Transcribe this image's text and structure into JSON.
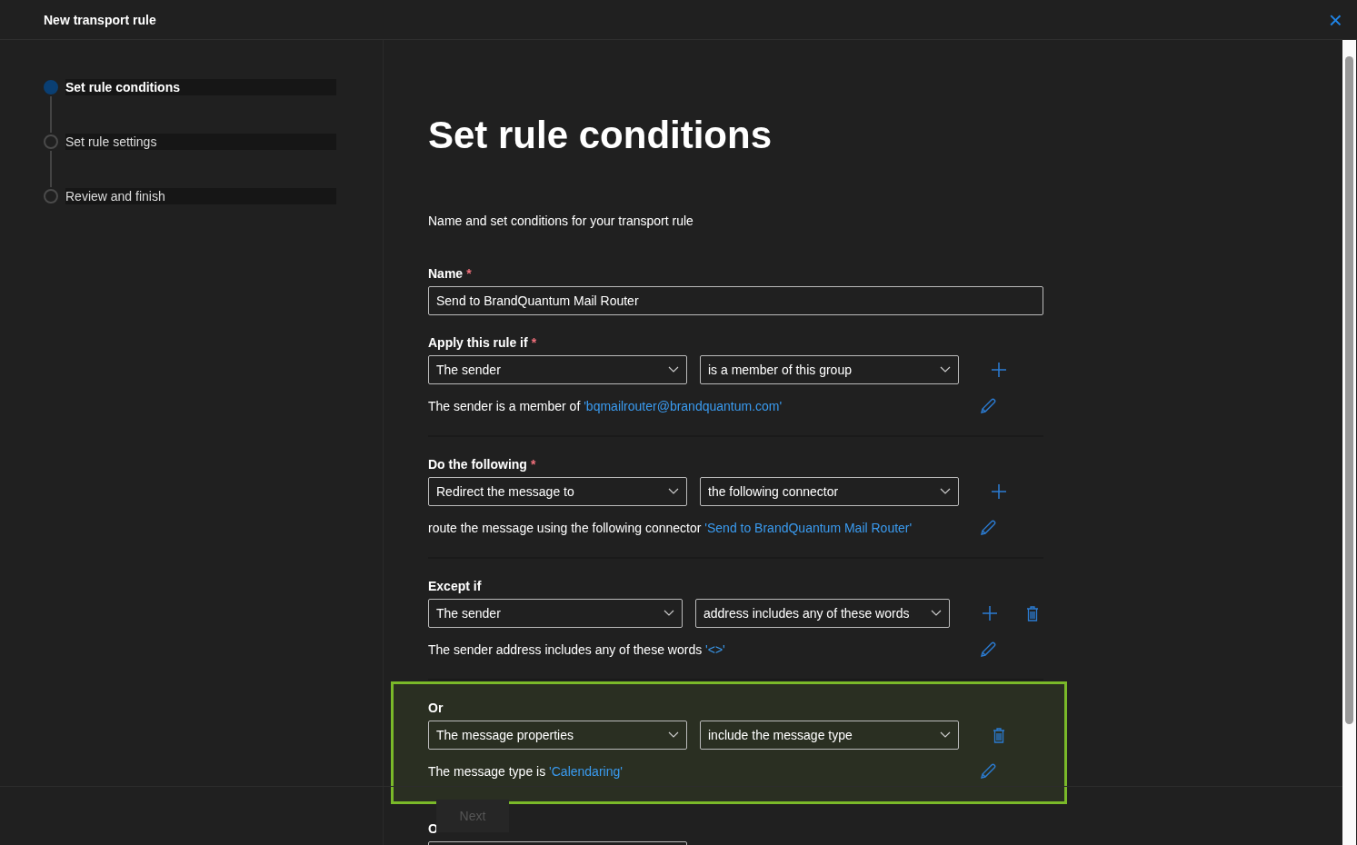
{
  "window": {
    "title": "New transport rule",
    "close": "×"
  },
  "steps": [
    {
      "label": "Set rule conditions",
      "selected": true
    },
    {
      "label": "Set rule settings",
      "selected": false
    },
    {
      "label": "Review and finish",
      "selected": false
    }
  ],
  "required_symbol": "*",
  "page_title": "Set rule conditions",
  "description": "Name and set conditions for your transport rule",
  "name_field": {
    "label": "Name",
    "required": true,
    "value": "Send to BrandQuantum Mail Router"
  },
  "sections": [
    {
      "title": "Apply this rule if",
      "required": true,
      "subject": "The sender",
      "condition": "is a member of this group",
      "summary": "The sender is a member of ",
      "value": "'bqmailrouter@brandquantum.com'",
      "can_add": true
    },
    {
      "title": "Do the following",
      "required": true,
      "subject": "Redirect the message to",
      "condition": "the following connector",
      "summary": "route the message using the following connector ",
      "value": "'Send to BrandQuantum Mail Router'",
      "can_add": true
    },
    {
      "title": "Except if",
      "subject": "The sender",
      "condition": "address includes any of these words",
      "summary": "The sender address includes any of these words ",
      "value": "'<>'",
      "can_add": true,
      "can_delete": true
    },
    {
      "title": "Or",
      "highlighted": true,
      "subject": "The message properties",
      "condition": "include the message type",
      "summary": "The message type is ",
      "value": "'Calendaring'",
      "can_delete": true
    },
    {
      "title": "O"
    }
  ],
  "footer": {
    "next": {
      "label": "Next",
      "disabled": true
    }
  }
}
